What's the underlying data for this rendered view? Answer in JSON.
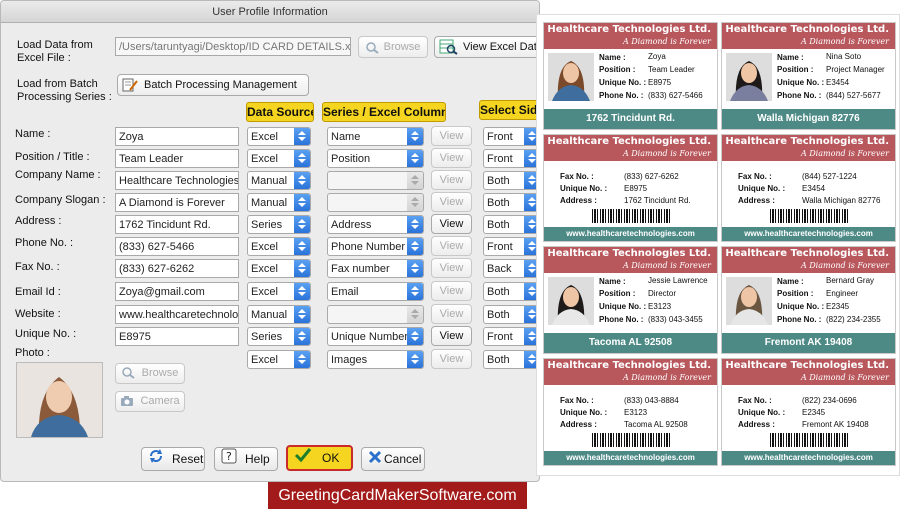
{
  "window": {
    "title": "User Profile Information"
  },
  "load": {
    "excel_label": "Load Data from Excel File :",
    "excel_path": "/Users/taruntyagi/Desktop/ID CARD DETAILS.x",
    "browse_label": "Browse",
    "view_excel_label": "View Excel Data",
    "batch_label": "Load from Batch Processing Series :",
    "batch_button_label": "Batch Processing Management"
  },
  "headers": {
    "source": "Data Source",
    "column": "Series / Excel Column",
    "side": "Select Side"
  },
  "fields": [
    {
      "label": "Name :",
      "value": "Zoya",
      "source": "Excel",
      "column": "Name",
      "view": "View",
      "view_enabled": false,
      "side": "Front"
    },
    {
      "label": "Position / Title :",
      "value": "Team Leader",
      "source": "Excel",
      "column": "Position",
      "view": "View",
      "view_enabled": false,
      "side": "Front"
    },
    {
      "label": "Company Name :",
      "value": "Healthcare Technologies",
      "source": "Manual",
      "column": "",
      "view": "View",
      "view_enabled": false,
      "side": "Both"
    },
    {
      "label": "Company Slogan :",
      "value": "A Diamond is Forever",
      "source": "Manual",
      "column": "",
      "view": "View",
      "view_enabled": false,
      "side": "Both"
    },
    {
      "label": "Address :",
      "value": "1762 Tincidunt Rd.",
      "source": "Series",
      "column": "Address",
      "view": "View",
      "view_enabled": true,
      "side": "Both"
    },
    {
      "label": "Phone No. :",
      "value": "(833) 627-5466",
      "source": "Excel",
      "column": "Phone Number",
      "view": "View",
      "view_enabled": false,
      "side": "Front"
    },
    {
      "label": "Fax No. :",
      "value": "(833) 627-6262",
      "source": "Excel",
      "column": "Fax number",
      "view": "View",
      "view_enabled": false,
      "side": "Back"
    },
    {
      "label": "Email Id :",
      "value": "Zoya@gmail.com",
      "source": "Excel",
      "column": "Email",
      "view": "View",
      "view_enabled": false,
      "side": "Both"
    },
    {
      "label": "Website :",
      "value": "www.healthcaretechnologi",
      "source": "Manual",
      "column": "",
      "view": "View",
      "view_enabled": false,
      "side": "Both"
    },
    {
      "label": "Unique No. :",
      "value": "E8975",
      "source": "Series",
      "column": "Unique Number",
      "view": "View",
      "view_enabled": true,
      "side": "Front"
    },
    {
      "label": "Photo :",
      "value": "",
      "source": "Excel",
      "column": "Images",
      "view": "View",
      "view_enabled": false,
      "side": "Both"
    }
  ],
  "photo": {
    "browse_label": "Browse",
    "camera_label": "Camera"
  },
  "buttons": {
    "reset": "Reset",
    "help": "Help",
    "ok": "OK",
    "cancel": "Cancel"
  },
  "brand": "GreetingCardMakerSoftware.com",
  "cards_common": {
    "company": "Healthcare Technologies Ltd.",
    "slogan": "A Diamond is Forever",
    "url": "www.healthcaretechnologies.com",
    "k_name": "Name :",
    "k_position": "Position :",
    "k_unique": "Unique No. :",
    "k_phone": "Phone No. :",
    "k_fax": "Fax No. :",
    "k_address": "Address :"
  },
  "colors": {
    "card_header": "#b8585d",
    "card_band": "#4d8a86",
    "highlight": "#f5d51f",
    "brand_bg": "#a21a1a"
  },
  "cards": [
    {
      "name": "Zoya",
      "position": "Team Leader",
      "unique": "E8975",
      "phone": "(833) 627-5466",
      "address": "1762 Tincidunt Rd.",
      "fax": "(833) 627-6262",
      "address_short": "1762 Tincidunt Rd."
    },
    {
      "name": "Nina Soto",
      "position": "Project Manager",
      "unique": "E3454",
      "phone": "(844) 527-5677",
      "address": "Walla Michigan 82776",
      "fax": "(844) 527-1224",
      "address_short": "Walla Michigan 82776"
    },
    {
      "name": "Jessie Lawrence",
      "position": "Director",
      "unique": "E3123",
      "phone": "(833) 043-3455",
      "address": "Tacoma AL 92508",
      "fax": "(833) 043-8884",
      "address_short": "Tacoma AL 92508"
    },
    {
      "name": "Bernard Gray",
      "position": "Engineer",
      "unique": "E2345",
      "phone": "(822) 234-2355",
      "address": "Fremont AK 19408",
      "fax": "(822) 234-0696",
      "address_short": "Fremont AK 19408"
    }
  ]
}
